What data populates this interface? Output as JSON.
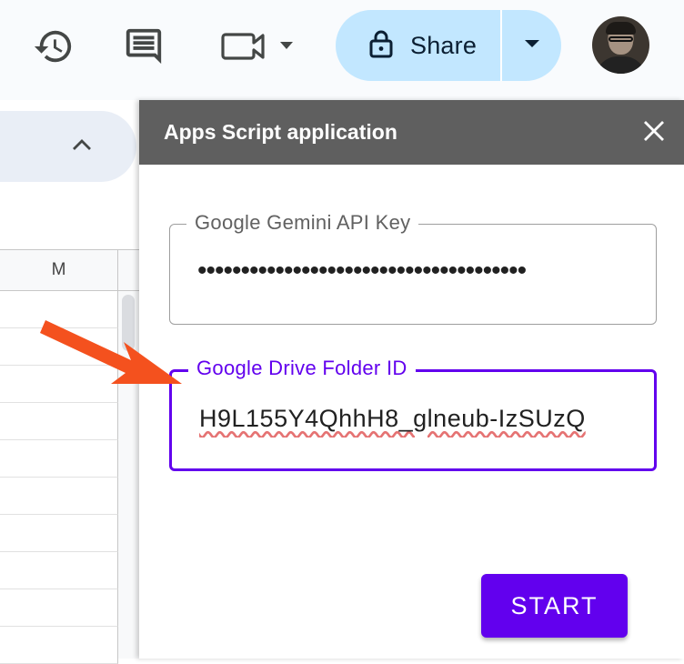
{
  "topbar": {
    "history_icon": "history-icon",
    "comment_icon": "comment-icon",
    "meet_icon": "video-camera-icon",
    "share": {
      "label": "Share",
      "icon": "lock-icon",
      "bg": "#c2e7ff"
    },
    "avatar": "user-avatar"
  },
  "sheet": {
    "column_header": "M",
    "collapse_icon": "chevron-up-icon"
  },
  "dialog": {
    "title": "Apps Script application",
    "header_bg": "#5f5f5f",
    "close_icon": "close-icon",
    "api_key": {
      "label": "Google Gemini API Key",
      "value": "••••••••••••••••••••••••••••••••••••••"
    },
    "drive_folder": {
      "label": "Google Drive Folder ID",
      "value": "H9L155Y4QhhH8_glneub-IzSUzQ"
    },
    "start_label": "START",
    "accent": "#6200ee"
  },
  "annotation": {
    "arrow_color": "#f4511e"
  }
}
